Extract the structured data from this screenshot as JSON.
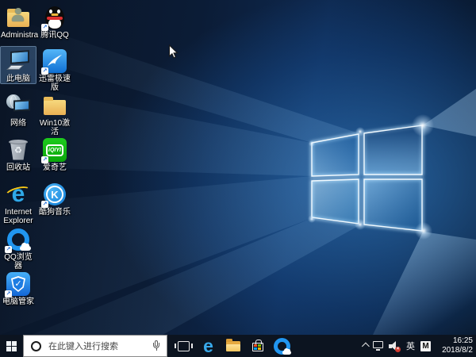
{
  "desktop_icons": [
    {
      "label": "Administra",
      "shortcut": false,
      "selected": false
    },
    {
      "label": "腾讯QQ",
      "shortcut": true,
      "selected": false
    },
    {
      "label": "此电脑",
      "shortcut": false,
      "selected": true
    },
    {
      "label": "迅雷极速版",
      "shortcut": true,
      "selected": false
    },
    {
      "label": "网络",
      "shortcut": false,
      "selected": false
    },
    {
      "label": "Win10激活",
      "shortcut": false,
      "selected": false
    },
    {
      "label": "回收站",
      "shortcut": false,
      "selected": false
    },
    {
      "label": "爱奇艺",
      "shortcut": true,
      "selected": false
    },
    {
      "label": "Internet Explorer",
      "shortcut": false,
      "selected": false
    },
    {
      "label": "酷狗音乐",
      "shortcut": true,
      "selected": false
    },
    {
      "label": "QQ浏览器",
      "shortcut": true,
      "selected": false
    },
    {
      "label": "电脑管家",
      "shortcut": true,
      "selected": false
    }
  ],
  "glyphs": {
    "iqiyi_text": "iQIYI",
    "kugou_letter": "K",
    "edge_letter": "e",
    "ie_letter": "e",
    "recycle_symbol": "♻",
    "shield_check": "✓",
    "shortcut_arrow": "↗",
    "mute_x": "×"
  },
  "taskbar": {
    "search_placeholder": "在此键入进行搜索",
    "tray": {
      "ime_lang": "英",
      "ime_mode": "M",
      "time": "16:25",
      "date": "2018/8/2"
    }
  },
  "colors": {
    "taskbar_bg": "#0c1420",
    "accent_blue": "#2196f0",
    "wallpaper_deep": "#081527"
  }
}
